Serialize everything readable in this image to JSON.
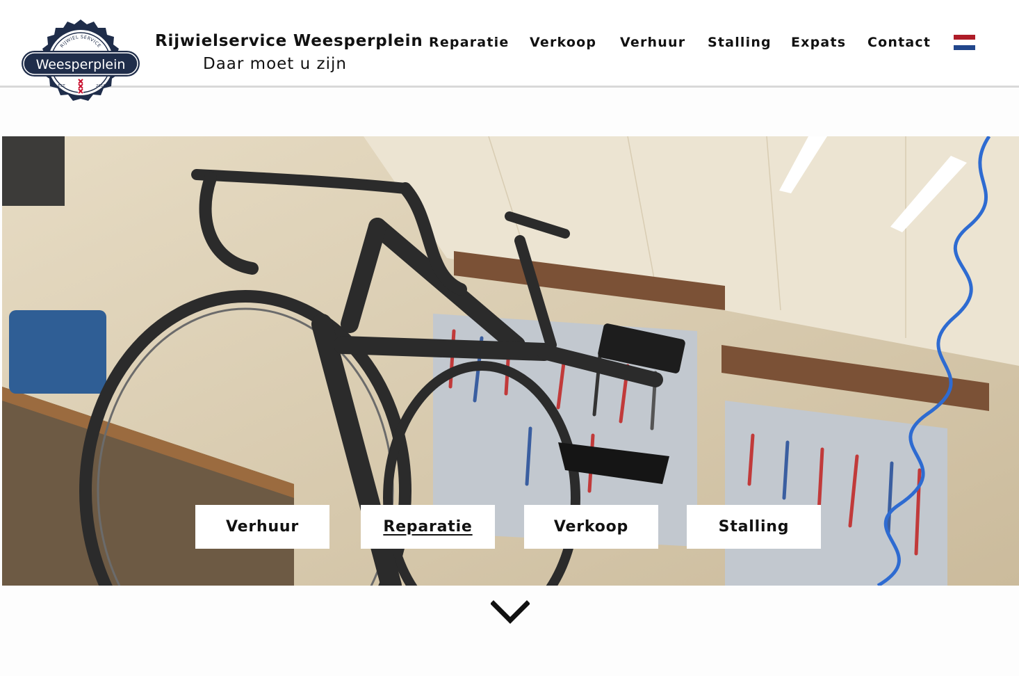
{
  "brand": {
    "logo_text": "Weesperplein",
    "logo_arc_text": "RIJWIEL SERVICE",
    "logo_est": "EST.",
    "logo_year": "2016",
    "title": "Rijwielservice Weesperplein",
    "tagline": "Daar moet u zijn"
  },
  "nav": {
    "items": [
      {
        "label": "Reparatie"
      },
      {
        "label": "Verkoop"
      },
      {
        "label": "Verhuur"
      },
      {
        "label": "Stalling"
      },
      {
        "label": "Expats"
      },
      {
        "label": "Contact"
      }
    ],
    "language_flag": "flag-nl-icon"
  },
  "hero": {
    "image": "bicycle-workshop-photo",
    "buttons": [
      {
        "label": "Verhuur"
      },
      {
        "label": "Reparatie",
        "active": true
      },
      {
        "label": "Verkoop"
      },
      {
        "label": "Stalling"
      }
    ]
  },
  "scroll": {
    "icon": "chevron-down-icon"
  },
  "colors": {
    "logo_navy": "#1f2d4a",
    "flag_red": "#ae1c28",
    "flag_white": "#ffffff",
    "flag_blue": "#21468b",
    "header_line": "#d9d9d9"
  }
}
